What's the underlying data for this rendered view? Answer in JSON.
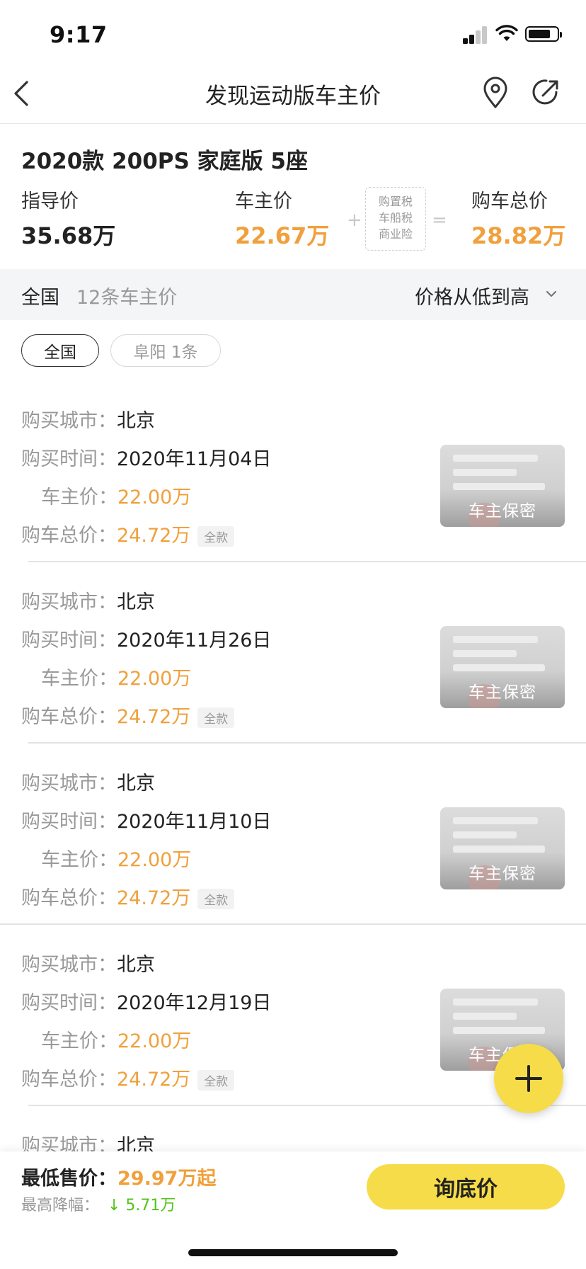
{
  "status_bar": {
    "time": "9:17"
  },
  "nav": {
    "title": "发现运动版车主价",
    "icons": [
      "back-icon",
      "location-pin-icon",
      "share-icon"
    ]
  },
  "model": {
    "title": "2020款 200PS 家庭版 5座",
    "guide_price_label": "指导价",
    "guide_price": "35.68万",
    "owner_price_label": "车主价",
    "owner_price": "22.67万",
    "tax_box": [
      "购置税",
      "车船税",
      "商业险"
    ],
    "plus": "+",
    "equals": "=",
    "total_price_label": "购车总价",
    "total_price": "28.82万"
  },
  "filter": {
    "region": "全国",
    "count": "12条车主价",
    "sort": "价格从低到高"
  },
  "chips": [
    {
      "label": "全国",
      "active": true
    },
    {
      "label": "阜阳 1条",
      "active": false
    }
  ],
  "labels": {
    "city": "购买城市：",
    "time": "购买时间：",
    "owner_price": "车主价：",
    "total": "购车总价："
  },
  "records": [
    {
      "city": "北京",
      "time": "2020年11月04日",
      "owner_price": "22.00万",
      "total": "24.72万",
      "tag": "全款",
      "thumb_text": "车主保密"
    },
    {
      "city": "北京",
      "time": "2020年11月26日",
      "owner_price": "22.00万",
      "total": "24.72万",
      "tag": "全款",
      "thumb_text": "车主保密"
    },
    {
      "city": "北京",
      "time": "2020年11月10日",
      "owner_price": "22.00万",
      "total": "24.72万",
      "tag": "全款",
      "thumb_text": "车主保密"
    },
    {
      "city": "北京",
      "time": "2020年12月19日",
      "owner_price": "22.00万",
      "total": "24.72万",
      "tag": "全款",
      "thumb_text": "车主保密"
    },
    {
      "city": "北京"
    }
  ],
  "bottom": {
    "min_price_label": "最低售价：",
    "min_price": "29.97万起",
    "max_drop_label": "最高降幅：",
    "max_drop": "↓ 5.71万",
    "inquiry_button": "询底价"
  },
  "colors": {
    "accent": "#f0a03c",
    "button_yellow": "#f6dc48",
    "drop_green": "#52c41a"
  }
}
